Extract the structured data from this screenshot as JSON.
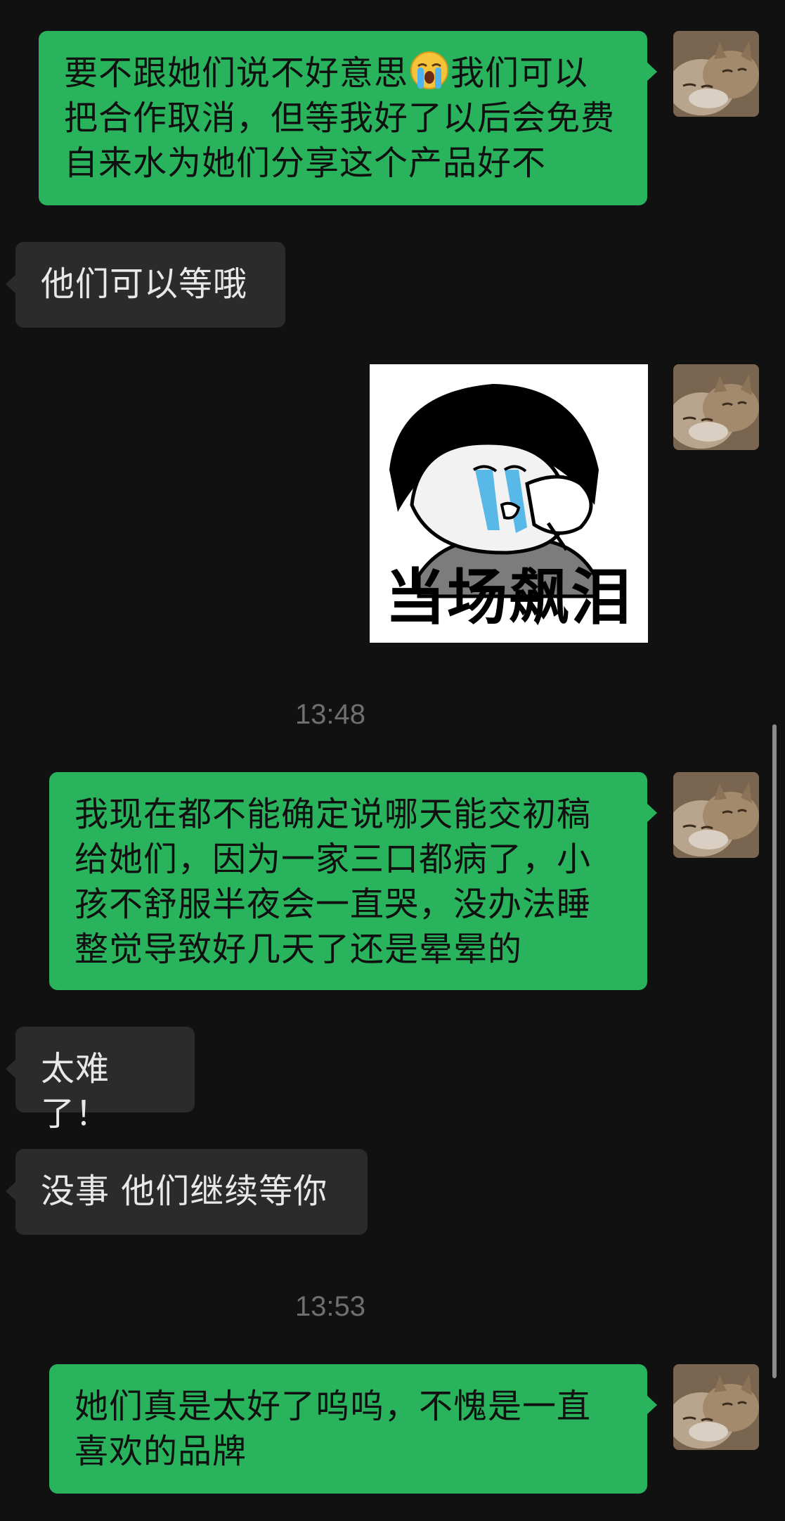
{
  "messages": {
    "m1": {
      "sender": "self",
      "text_before_emoji": "要不跟她们说不好意思",
      "emoji": "loudly-crying-face",
      "text_after_emoji": "我们可以把合作取消，但等我好了以后会免费自来水为她们分享这个产品好不"
    },
    "m2": {
      "sender": "other",
      "text": "他们可以等哦"
    },
    "m3": {
      "sender": "self",
      "type": "sticker",
      "caption": "当场飙泪"
    },
    "time1": "13:48",
    "m4": {
      "sender": "self",
      "text": "我现在都不能确定说哪天能交初稿给她们，因为一家三口都病了，小孩不舒服半夜会一直哭，没办法睡整觉导致好几天了还是晕晕的"
    },
    "m5": {
      "sender": "other",
      "text": "太难了！"
    },
    "m6": {
      "sender": "other",
      "text": "没事 他们继续等你"
    },
    "time2": "13:53",
    "m7": {
      "sender": "self",
      "text": "她们真是太好了呜呜，不愧是一直喜欢的品牌"
    }
  },
  "colors": {
    "background": "#111111",
    "outgoing_bubble": "#29b35c",
    "incoming_bubble": "#2b2b2b",
    "timestamp": "#6f6f6f"
  },
  "avatar": {
    "icon": "cat-avatar-icon"
  }
}
